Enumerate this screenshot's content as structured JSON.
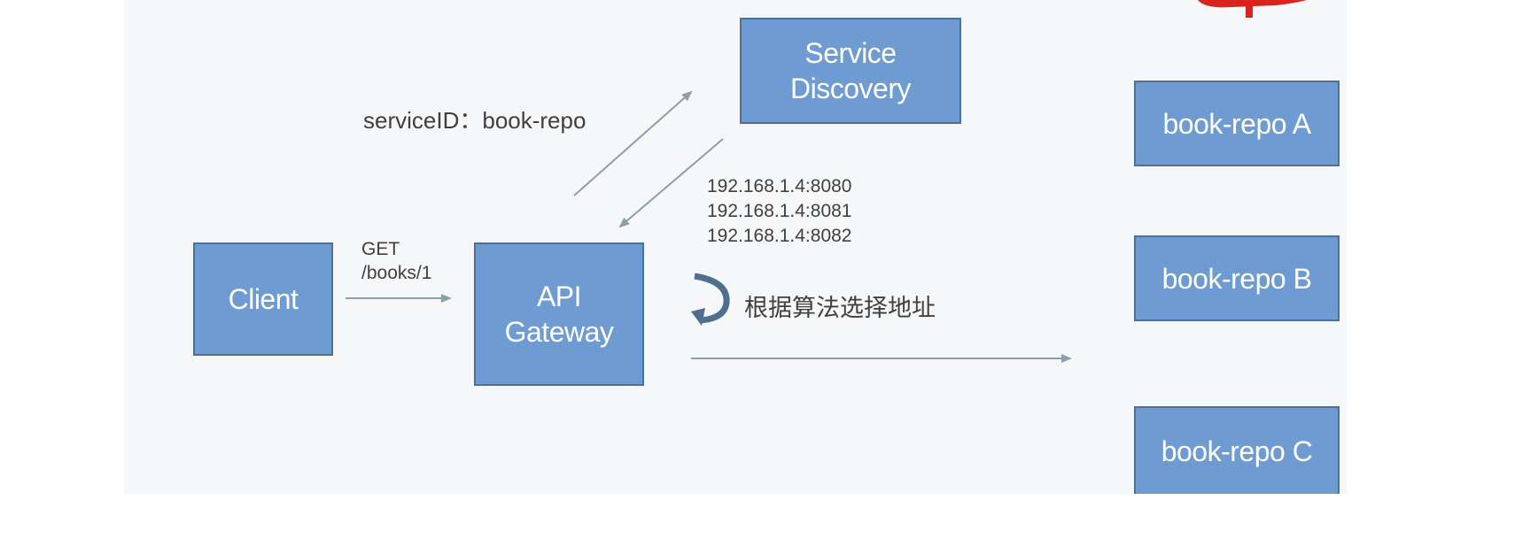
{
  "nodes": {
    "client": "Client",
    "api_gateway": {
      "line1": "API",
      "line2": "Gateway"
    },
    "service_discovery": {
      "line1": "Service",
      "line2": "Discovery"
    },
    "repo_a": "book-repo A",
    "repo_b": "book-repo B",
    "repo_c": "book-repo C"
  },
  "labels": {
    "service_id": "serviceID：book-repo",
    "request_method": "GET",
    "request_path": "/books/1",
    "addresses": [
      "192.168.1.4:8080",
      "192.168.1.4:8081",
      "192.168.1.4:8082"
    ],
    "algorithm": "根据算法选择地址"
  },
  "colors": {
    "box_fill": "#6e9bd1",
    "box_border": "#4d6f98",
    "arrow": "#8aa0ab",
    "curved_arrow": "#4f6f8f",
    "accent_red": "#d8241c"
  },
  "icons": {
    "curved_arrow": "curved-return-arrow-icon"
  }
}
